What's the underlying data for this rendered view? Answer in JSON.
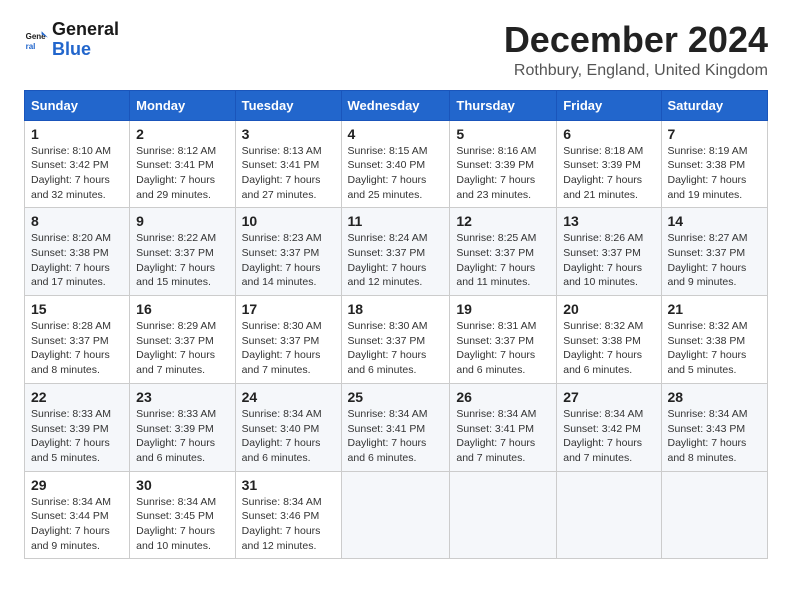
{
  "logo": {
    "line1": "General",
    "line2": "Blue"
  },
  "title": "December 2024",
  "location": "Rothbury, England, United Kingdom",
  "days_of_week": [
    "Sunday",
    "Monday",
    "Tuesday",
    "Wednesday",
    "Thursday",
    "Friday",
    "Saturday"
  ],
  "weeks": [
    [
      {
        "day": "1",
        "sunrise": "Sunrise: 8:10 AM",
        "sunset": "Sunset: 3:42 PM",
        "daylight": "Daylight: 7 hours and 32 minutes."
      },
      {
        "day": "2",
        "sunrise": "Sunrise: 8:12 AM",
        "sunset": "Sunset: 3:41 PM",
        "daylight": "Daylight: 7 hours and 29 minutes."
      },
      {
        "day": "3",
        "sunrise": "Sunrise: 8:13 AM",
        "sunset": "Sunset: 3:41 PM",
        "daylight": "Daylight: 7 hours and 27 minutes."
      },
      {
        "day": "4",
        "sunrise": "Sunrise: 8:15 AM",
        "sunset": "Sunset: 3:40 PM",
        "daylight": "Daylight: 7 hours and 25 minutes."
      },
      {
        "day": "5",
        "sunrise": "Sunrise: 8:16 AM",
        "sunset": "Sunset: 3:39 PM",
        "daylight": "Daylight: 7 hours and 23 minutes."
      },
      {
        "day": "6",
        "sunrise": "Sunrise: 8:18 AM",
        "sunset": "Sunset: 3:39 PM",
        "daylight": "Daylight: 7 hours and 21 minutes."
      },
      {
        "day": "7",
        "sunrise": "Sunrise: 8:19 AM",
        "sunset": "Sunset: 3:38 PM",
        "daylight": "Daylight: 7 hours and 19 minutes."
      }
    ],
    [
      {
        "day": "8",
        "sunrise": "Sunrise: 8:20 AM",
        "sunset": "Sunset: 3:38 PM",
        "daylight": "Daylight: 7 hours and 17 minutes."
      },
      {
        "day": "9",
        "sunrise": "Sunrise: 8:22 AM",
        "sunset": "Sunset: 3:37 PM",
        "daylight": "Daylight: 7 hours and 15 minutes."
      },
      {
        "day": "10",
        "sunrise": "Sunrise: 8:23 AM",
        "sunset": "Sunset: 3:37 PM",
        "daylight": "Daylight: 7 hours and 14 minutes."
      },
      {
        "day": "11",
        "sunrise": "Sunrise: 8:24 AM",
        "sunset": "Sunset: 3:37 PM",
        "daylight": "Daylight: 7 hours and 12 minutes."
      },
      {
        "day": "12",
        "sunrise": "Sunrise: 8:25 AM",
        "sunset": "Sunset: 3:37 PM",
        "daylight": "Daylight: 7 hours and 11 minutes."
      },
      {
        "day": "13",
        "sunrise": "Sunrise: 8:26 AM",
        "sunset": "Sunset: 3:37 PM",
        "daylight": "Daylight: 7 hours and 10 minutes."
      },
      {
        "day": "14",
        "sunrise": "Sunrise: 8:27 AM",
        "sunset": "Sunset: 3:37 PM",
        "daylight": "Daylight: 7 hours and 9 minutes."
      }
    ],
    [
      {
        "day": "15",
        "sunrise": "Sunrise: 8:28 AM",
        "sunset": "Sunset: 3:37 PM",
        "daylight": "Daylight: 7 hours and 8 minutes."
      },
      {
        "day": "16",
        "sunrise": "Sunrise: 8:29 AM",
        "sunset": "Sunset: 3:37 PM",
        "daylight": "Daylight: 7 hours and 7 minutes."
      },
      {
        "day": "17",
        "sunrise": "Sunrise: 8:30 AM",
        "sunset": "Sunset: 3:37 PM",
        "daylight": "Daylight: 7 hours and 7 minutes."
      },
      {
        "day": "18",
        "sunrise": "Sunrise: 8:30 AM",
        "sunset": "Sunset: 3:37 PM",
        "daylight": "Daylight: 7 hours and 6 minutes."
      },
      {
        "day": "19",
        "sunrise": "Sunrise: 8:31 AM",
        "sunset": "Sunset: 3:37 PM",
        "daylight": "Daylight: 7 hours and 6 minutes."
      },
      {
        "day": "20",
        "sunrise": "Sunrise: 8:32 AM",
        "sunset": "Sunset: 3:38 PM",
        "daylight": "Daylight: 7 hours and 6 minutes."
      },
      {
        "day": "21",
        "sunrise": "Sunrise: 8:32 AM",
        "sunset": "Sunset: 3:38 PM",
        "daylight": "Daylight: 7 hours and 5 minutes."
      }
    ],
    [
      {
        "day": "22",
        "sunrise": "Sunrise: 8:33 AM",
        "sunset": "Sunset: 3:39 PM",
        "daylight": "Daylight: 7 hours and 5 minutes."
      },
      {
        "day": "23",
        "sunrise": "Sunrise: 8:33 AM",
        "sunset": "Sunset: 3:39 PM",
        "daylight": "Daylight: 7 hours and 6 minutes."
      },
      {
        "day": "24",
        "sunrise": "Sunrise: 8:34 AM",
        "sunset": "Sunset: 3:40 PM",
        "daylight": "Daylight: 7 hours and 6 minutes."
      },
      {
        "day": "25",
        "sunrise": "Sunrise: 8:34 AM",
        "sunset": "Sunset: 3:41 PM",
        "daylight": "Daylight: 7 hours and 6 minutes."
      },
      {
        "day": "26",
        "sunrise": "Sunrise: 8:34 AM",
        "sunset": "Sunset: 3:41 PM",
        "daylight": "Daylight: 7 hours and 7 minutes."
      },
      {
        "day": "27",
        "sunrise": "Sunrise: 8:34 AM",
        "sunset": "Sunset: 3:42 PM",
        "daylight": "Daylight: 7 hours and 7 minutes."
      },
      {
        "day": "28",
        "sunrise": "Sunrise: 8:34 AM",
        "sunset": "Sunset: 3:43 PM",
        "daylight": "Daylight: 7 hours and 8 minutes."
      }
    ],
    [
      {
        "day": "29",
        "sunrise": "Sunrise: 8:34 AM",
        "sunset": "Sunset: 3:44 PM",
        "daylight": "Daylight: 7 hours and 9 minutes."
      },
      {
        "day": "30",
        "sunrise": "Sunrise: 8:34 AM",
        "sunset": "Sunset: 3:45 PM",
        "daylight": "Daylight: 7 hours and 10 minutes."
      },
      {
        "day": "31",
        "sunrise": "Sunrise: 8:34 AM",
        "sunset": "Sunset: 3:46 PM",
        "daylight": "Daylight: 7 hours and 12 minutes."
      },
      null,
      null,
      null,
      null
    ]
  ]
}
